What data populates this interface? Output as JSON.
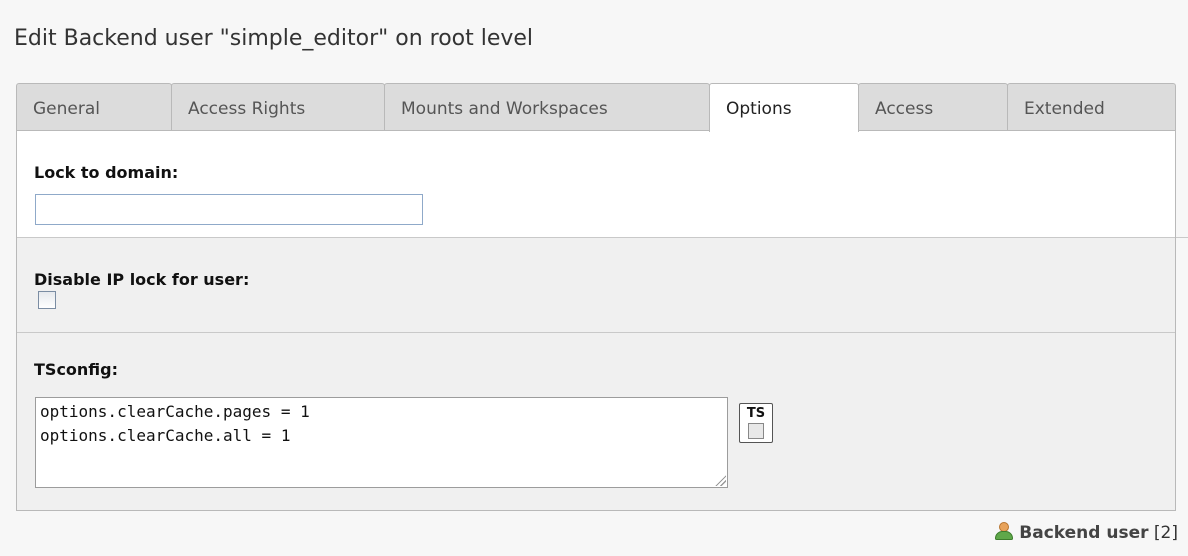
{
  "page": {
    "title": "Edit Backend user \"simple_editor\" on root level"
  },
  "tabs": [
    {
      "label": "General",
      "active": false
    },
    {
      "label": "Access Rights",
      "active": false
    },
    {
      "label": "Mounts and Workspaces",
      "active": false
    },
    {
      "label": "Options",
      "active": true
    },
    {
      "label": "Access",
      "active": false
    },
    {
      "label": "Extended",
      "active": false
    }
  ],
  "fields": {
    "lock_to_domain": {
      "label": "Lock to domain:",
      "value": ""
    },
    "disable_ip_lock": {
      "label": "Disable IP lock for user:",
      "checked": false
    },
    "tsconfig": {
      "label": "TSconfig:",
      "value": "options.clearCache.pages = 1\noptions.clearCache.all = 1",
      "button_icon_text": "TS"
    }
  },
  "footer": {
    "record_type": "Backend user",
    "record_id": "[2]"
  },
  "icons": {
    "user": "backend-user-icon",
    "ts_wizard": "tsconfig-wizard-icon"
  }
}
